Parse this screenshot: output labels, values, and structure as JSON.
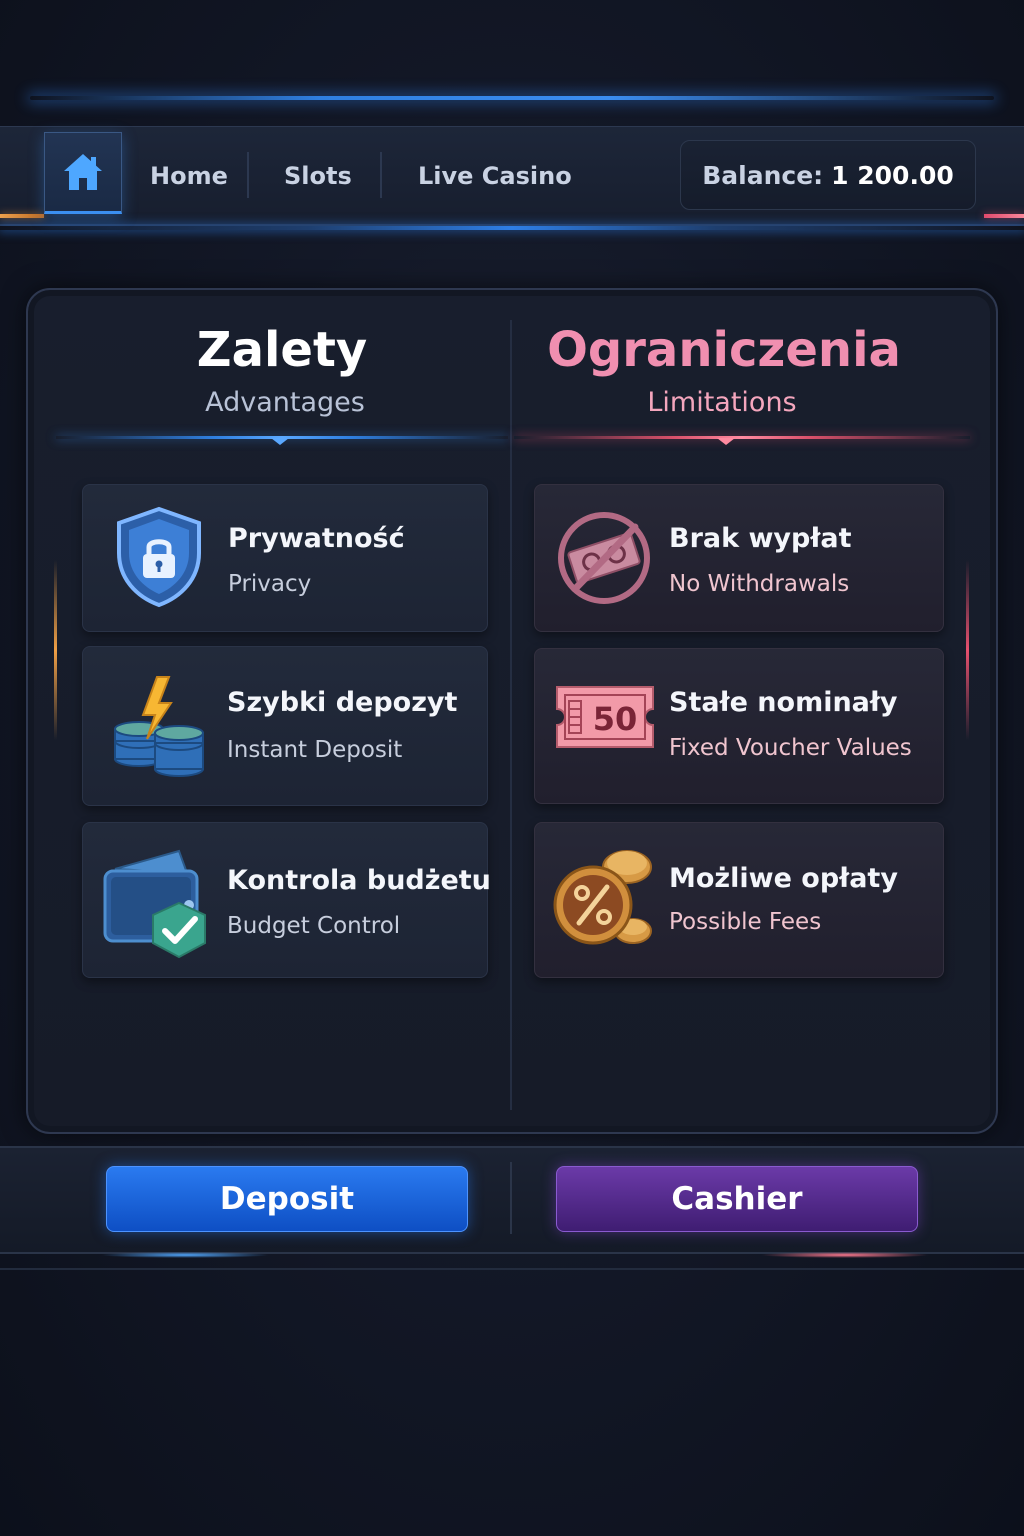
{
  "nav": {
    "home_icon": "home-icon",
    "links": [
      "Home",
      "Slots",
      "Live Casino"
    ],
    "balance_label": "Balance:",
    "balance_amount": "1 200.00"
  },
  "advantages": {
    "title": "Zalety",
    "subtitle": "Advantages",
    "accent_color": "#3b8ff0",
    "items": [
      {
        "title": "Prywatność",
        "subtitle": "Privacy",
        "icon": "shield-lock-icon"
      },
      {
        "title": "Szybki depozyt",
        "subtitle": "Instant Deposit",
        "icon": "coins-lightning-icon"
      },
      {
        "title": "Kontrola budżetu",
        "subtitle": "Budget Control",
        "icon": "wallet-check-icon"
      }
    ]
  },
  "limitations": {
    "title": "Ograniczenia",
    "subtitle": "Limitations",
    "accent_color": "#f08fb0",
    "items": [
      {
        "title": "Brak wypłat",
        "subtitle": "No Withdrawals",
        "icon": "no-cash-icon"
      },
      {
        "title": "Stałe nominały",
        "subtitle": "Fixed Voucher Values",
        "icon": "voucher-50-icon",
        "badge": "50"
      },
      {
        "title": "Możliwe opłaty",
        "subtitle": "Possible Fees",
        "icon": "percent-coins-icon"
      }
    ]
  },
  "footer": {
    "deposit_label": "Deposit",
    "cashier_label": "Cashier"
  }
}
